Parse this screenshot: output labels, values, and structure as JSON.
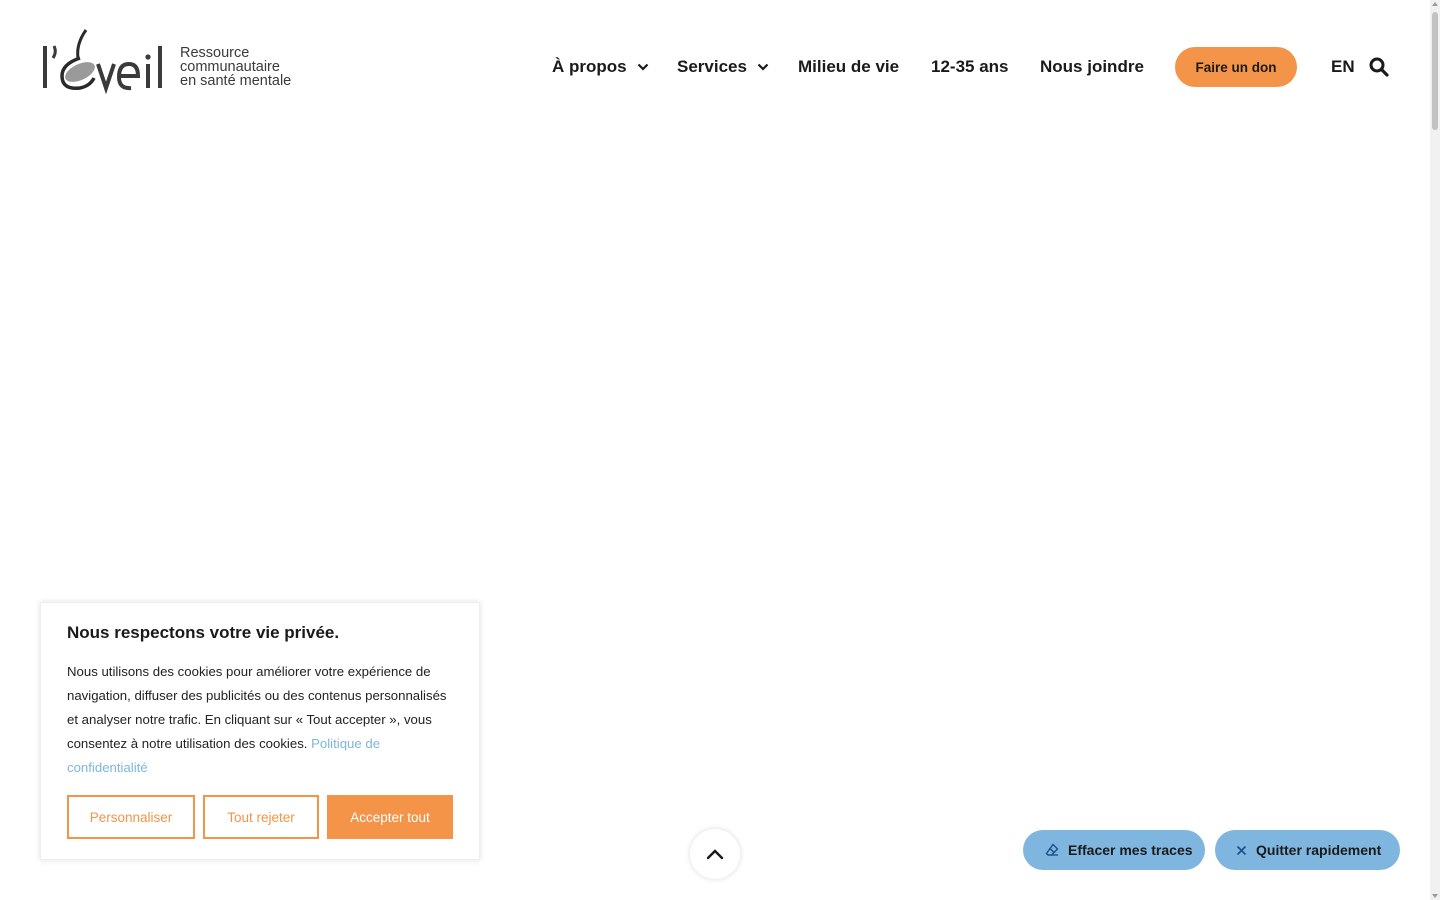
{
  "logo": {
    "wordmark": "l’Éveil",
    "tagline": [
      "Ressource",
      "communautaire",
      "en santé mentale"
    ]
  },
  "nav": {
    "items": [
      {
        "label": "À propos",
        "has_dropdown": true
      },
      {
        "label": "Services",
        "has_dropdown": true
      },
      {
        "label": "Milieu de vie",
        "has_dropdown": false
      },
      {
        "label": "12-35 ans",
        "has_dropdown": false
      },
      {
        "label": "Nous joindre",
        "has_dropdown": false
      }
    ],
    "donate_label": "Faire un don",
    "lang_label": "EN"
  },
  "cookie": {
    "title": "Nous respectons votre vie privée.",
    "text": "Nous utilisons des cookies pour améliorer votre expérience de navigation, diffuser des publicités ou des contenus personnalisés et analyser notre trafic. En cliquant sur « Tout accepter », vous consentez à notre utilisation des cookies.",
    "link_label": "Politique de confidentialité",
    "buttons": {
      "customize": "Personnaliser",
      "reject": "Tout rejeter",
      "accept": "Accepter tout"
    }
  },
  "fabs": {
    "erase_label": "Effacer mes traces",
    "quit_label": "Quitter rapidement"
  },
  "colors": {
    "accent_orange": "#f39448",
    "accent_blue": "#7fb6df",
    "link_blue": "#7eb6dc",
    "text_dark": "#1a1a1a"
  },
  "icons": {
    "search": "search-icon",
    "chevron": "chevron-down-icon",
    "back_to_top": "chevron-up-icon",
    "eraser": "eraser-icon",
    "close": "close-icon"
  }
}
